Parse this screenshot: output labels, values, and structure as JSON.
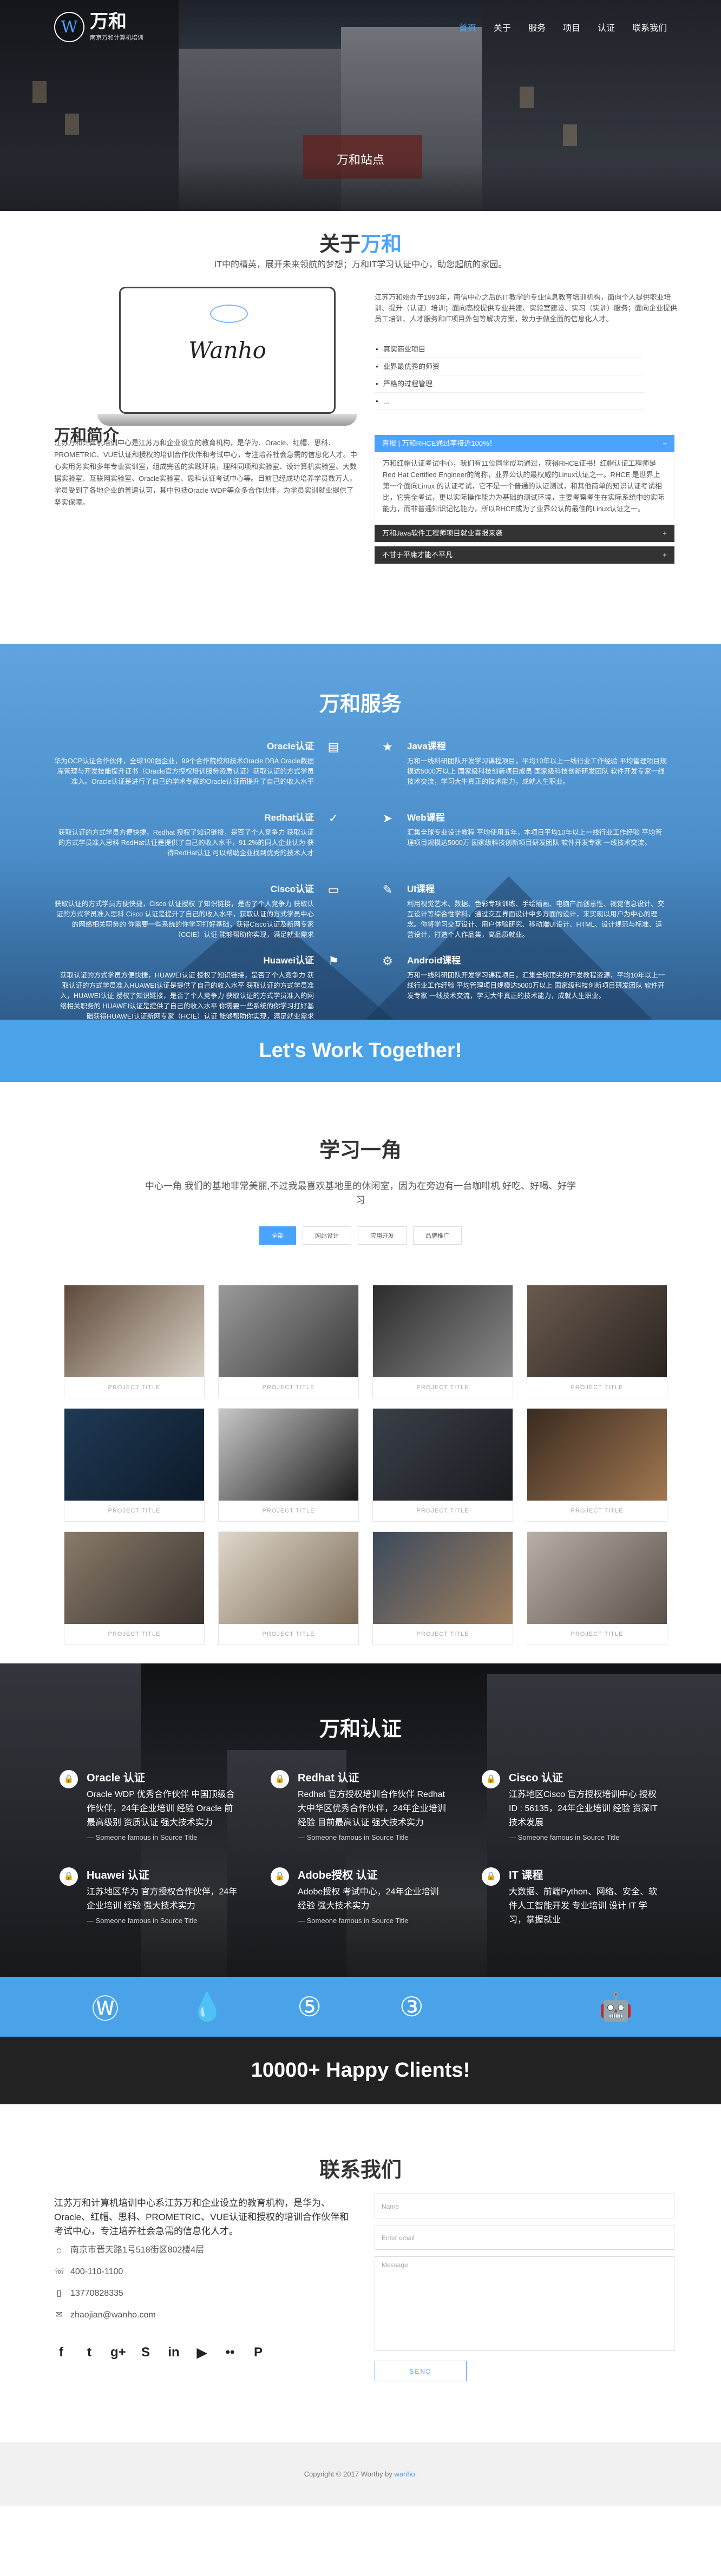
{
  "nav": {
    "logo_text": "万和",
    "logo_sub": "南京万和计算机培训",
    "items": [
      "首页",
      "关于",
      "服务",
      "项目",
      "认证",
      "联系我们"
    ]
  },
  "hero": {
    "caption": "万和站点"
  },
  "about": {
    "title_prefix": "关于",
    "title_highlight": "万和",
    "lead": "IT中的精英，展开未来领航的梦想；万和IT学习认证中心，助您起航的家园。",
    "laptop_wordmark": "Wanho",
    "right_text": "江苏万和始办于1993年，南信中心之后的IT教学的专业信息教育培训机构，面向个人提供职业培训、提升（认证）培训；面向高校提供专业共建、实验室建设、实习（实训）服务；面向企业提供员工培训、人才服务和IT项目外包等解决方案，致力于做全面的信息化人才。",
    "bullets": [
      "真实商业项目",
      "业界最优秀的师资",
      "严格的过程管理",
      "..."
    ],
    "intro_title": "万和简介",
    "intro_text": "江苏万和计算机培训中心是江苏万和企业设立的教育机构，是华为、Oracle、红帽、思科、PROMETRIC、VUE认证和授权的培训合作伙伴和考试中心，专注培养社会急需的信息化人才。中心实用务实和多年专业实训室，组成完善的实践环境，理科同项和实验室、设计算机实验室、大数据实验室、互联网实验室、Oracle实验室、思科认证考试中心等。目前已经成功培养学员数万人，学员受到了各地企业的普遍认可，其中包括Oracle WDP等众多合作伙伴，为学员实训就业提供了坚实保障。",
    "accordion": [
      {
        "title": "喜报 | 万和RHCE通过率接近100%！",
        "open": true,
        "body": "万和红帽认证考试中心，我们有11位同学成功通过，获得RHCE证书！红帽认证工程师是Red Hat Certified Engineer的简称，业界公认的最权威的Linux认证之一。RHCE 是世界上第一个面向Linux 的认证考试，它不是一个普通的认证测试，和其他简单的知识认证考试相比，它完全考试，更以实际操作能力为基础的测试环境，主要考察考生在实际系统中的实际能力，而非普通知识记忆能力，所以RHCE成为了业界公认的最佳的Linux认证之一。"
      },
      {
        "title": "万和Java软件工程师项目就业喜报来袭",
        "open": false,
        "body": ""
      },
      {
        "title": "不甘于平庸才能不平凡",
        "open": false,
        "body": ""
      }
    ]
  },
  "services": {
    "title": "万和服务",
    "left": [
      {
        "name": "Oracle认证",
        "icon": "database-icon",
        "desc": "华为OCP认证合作伙伴，全球100强企业，99个合作院校和技术Oracle DBA Oracle数据库管理与开发技能提升证书（Oracle官方授权培训服务资质认证）获取认证的方式学员准入。Oracle认证是进行了自己的学术专家的Oracle认证而提升了自己的收入水平"
      },
      {
        "name": "Redhat认证",
        "icon": "check-icon",
        "desc": "获取认证的方式学员方便快捷，Redhat 授权了知识链接，是否了个人竞争力 获取认证的方式学员准入思科 RedHat认证是提供了自己的收入水平，91.2%的同人企业认为 获得RedHat认证 可以帮助企业找到优秀的技术人才"
      },
      {
        "name": "Cisco认证",
        "icon": "desktop-icon",
        "desc": "获取认证的方式学员方便快捷，Cisco 认证授权 了知识链接，是否了个人竞争力 获取认证的方式学员准入思科 Cisco 认证是提升了自己的收入水平，获取认证的方式学员中心的网络相关职务的 你需要一些系统的你学习打好基础，获得Cisco认证及新网专家（CCIE）认证 能够帮助你实现，满足就业需求"
      },
      {
        "name": "Huawei认证",
        "icon": "flag-icon",
        "desc": "获取认证的方式学员方便快捷，HUAWEI认证 授权了知识链接，是否了个人竞争力 获取认证的方式学员准入HUAWEI认证是提供了自己的收入水平 获取认证的方式学员准入，HUAWEI认证 授权了知识链接，是否了个人竞争力 获取认证的方式学员准入的网络相关职务的 HUAWEI认证是提供了自己的收入水平 你需要一些系统的你学习打好基础获得HUAWEI认证新网专家（HCIE）认证 能够帮助你实现，满足就业需求"
      }
    ],
    "right": [
      {
        "name": "Java课程",
        "icon": "star-icon",
        "desc": "万和一线科研团队开发学习课程项目，平均10年以上一线行业工作经验 平均管理项目规模达5000万以上 国家级科技创新项目成员 国家级科技创新研发团队 软件开发专家一线技术交流，学习大牛真正的技术能力，成就人生职业。"
      },
      {
        "name": "Web课程",
        "icon": "send-icon",
        "desc": "汇集全球专业设计教程 平均使用五年，本项目平均10年以上一线行业工作经验 平均管理项目规模达5000万 国家级科技创新项目研发团队 软件开发专家 一线技术交流。"
      },
      {
        "name": "UI课程",
        "icon": "pencil-icon",
        "desc": "利用视觉艺术、数据、色彩专项训练、手绘插画、电脑产品创意性、视觉信息设计、交互设计等综合性学科，通过交互界面设计中多方面的设计，来实现以用户为中心的理念。你将学习交互设计、用户体验研究、移动端UI设计、HTML、设计规范与标准、运营设计，打造个人作品集，高品质就业。"
      },
      {
        "name": "Android课程",
        "icon": "gear-icon",
        "desc": "万和一线科研团队开发学习课程项目，汇集全球顶尖的开发教程资源，平均10年以上一线行业工作经验 平均管理项目规模达5000万以上 国家级科技创新项目研发团队 软件开发专家 一线技术交流，学习大牛真正的技术能力，成就人生职业。"
      }
    ],
    "cta": "Let's Work Together!"
  },
  "learn": {
    "title": "学习一角",
    "desc": "中心一角 我们的基地非常美丽,不过我最喜欢基地里的休闲室，因为在旁边有一台咖啡机 好吃、好喝、好学习",
    "filters": [
      "全部",
      "网站设计",
      "应用开发",
      "品牌推广"
    ],
    "tile_caption": "PROJECT TITLE",
    "tiles": [
      {
        "c1": "#5e4a3a",
        "c2": "#d8cfc4"
      },
      {
        "c1": "#9a9a9a",
        "c2": "#3a3a3a"
      },
      {
        "c1": "#2c2c2c",
        "c2": "#8a8a8a"
      },
      {
        "c1": "#6a5a4e",
        "c2": "#2a2420"
      },
      {
        "c1": "#1f3a55",
        "c2": "#0d1a2a"
      },
      {
        "c1": "#c8c8c8",
        "c2": "#1a1a1a"
      },
      {
        "c1": "#3a3f48",
        "c2": "#1a1c20"
      },
      {
        "c1": "#3a2a20",
        "c2": "#a07850"
      },
      {
        "c1": "#8a7a6a",
        "c2": "#3a342e"
      },
      {
        "c1": "#e0d8cc",
        "c2": "#7a6a56"
      },
      {
        "c1": "#3c4a5c",
        "c2": "#a08060"
      },
      {
        "c1": "#b8b0a6",
        "c2": "#5a524a"
      }
    ]
  },
  "cert": {
    "title": "万和认证",
    "source": "— Someone famous in Source Title",
    "items": [
      {
        "name": "Oracle 认证",
        "icon": "lock-icon",
        "text": "Oracle WDP 优秀合作伙伴 中国顶级合作伙伴，24年企业培训 经验 Oracle 前最高级别 资质认证 强大技术实力"
      },
      {
        "name": "Redhat 认证",
        "icon": "lock-icon",
        "text": "Redhat 官方授权培训合作伙伴 Redhat 大中华区优秀合作伙伴，24年企业培训 经验 目前最高认证 强大技术实力"
      },
      {
        "name": "Cisco 认证",
        "icon": "lock-icon",
        "text": "江苏地区Cisco 官方授权培训中心 授权ID : 56135，24年企业培训 经验 资深IT 技术发展"
      },
      {
        "name": "Huawei 认证",
        "icon": "lock-icon",
        "text": "江苏地区华为 官方授权合作伙伴，24年 企业培训 经验 强大技术实力"
      },
      {
        "name": "Adobe授权 认证",
        "icon": "lock-icon",
        "text": "Adobe授权 考试中心，24年企业培训 经验 强大技术实力"
      },
      {
        "name": "IT 课程",
        "icon": "lock-icon",
        "text": "大数据、前端Python、网络、安全、软件人工智能开发 专业培训 设计 IT 学习，掌握就业"
      }
    ]
  },
  "brands": [
    "wordpress-icon",
    "drupal-icon",
    "html5-icon",
    "css3-icon",
    "apple-icon",
    "android-icon"
  ],
  "clients": "10000+ Happy Clients!",
  "contact": {
    "title": "联系我们",
    "text": "江苏万和计算机培训中心系江苏万和企业设立的教育机构，是华为、Oracle、红帽、思科、PROMETRIC、VUE认证和授权的培训合作伙伴和考试中心，专注培养社会急需的信息化人才。",
    "address": "南京市晋天路1号518街区802楼4层",
    "phone": "400-110-1100",
    "mobile": "13770828335",
    "email": "zhaojian@wanho.com",
    "socials": [
      "facebook-icon",
      "twitter-icon",
      "google-plus-icon",
      "skype-icon",
      "linkedin-icon",
      "youtube-icon",
      "flickr-icon",
      "pinterest-icon"
    ],
    "form": {
      "name": "Name",
      "email": "Enter email",
      "message": "Message",
      "send": "SEND"
    }
  },
  "footer": {
    "prefix": "Copyright © 2017 Worthy by ",
    "by": "wanho."
  }
}
